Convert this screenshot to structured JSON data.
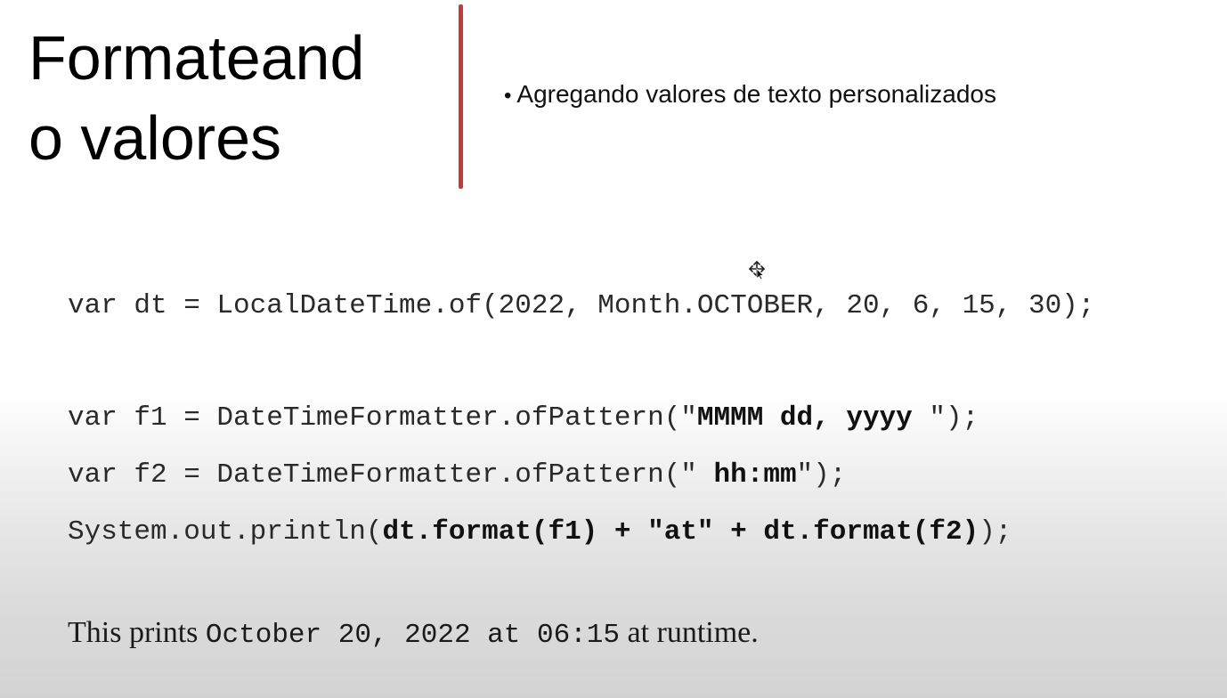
{
  "slide": {
    "title_line1": "Formateand",
    "title_line2": "o valores",
    "bullet_symbol": "•",
    "bullet_text": "Agregando valores de texto personalizados",
    "divider_color": "#c53a3a"
  },
  "code": {
    "line1": "var dt = LocalDateTime.of(2022, Month.OCTOBER, 20, 6, 15, 30);",
    "line2_prefix": "var f1 = DateTimeFormatter.ofPattern(\"",
    "line2_bold": "MMMM dd, yyyy ",
    "line2_suffix": "\");",
    "line3_prefix": "var f2 = DateTimeFormatter.ofPattern(\" ",
    "line3_bold": "hh:mm",
    "line3_suffix": "\");",
    "line4_prefix": "System.out.println(",
    "line4_bold": "dt.format(f1) + \"at\" + dt.format(f2)",
    "line4_suffix": ");"
  },
  "result": {
    "prefix": "This prints ",
    "mono": "October 20, 2022 at 06:15",
    "suffix": " at runtime."
  },
  "icons": {
    "cursor": "move-cursor-icon"
  }
}
